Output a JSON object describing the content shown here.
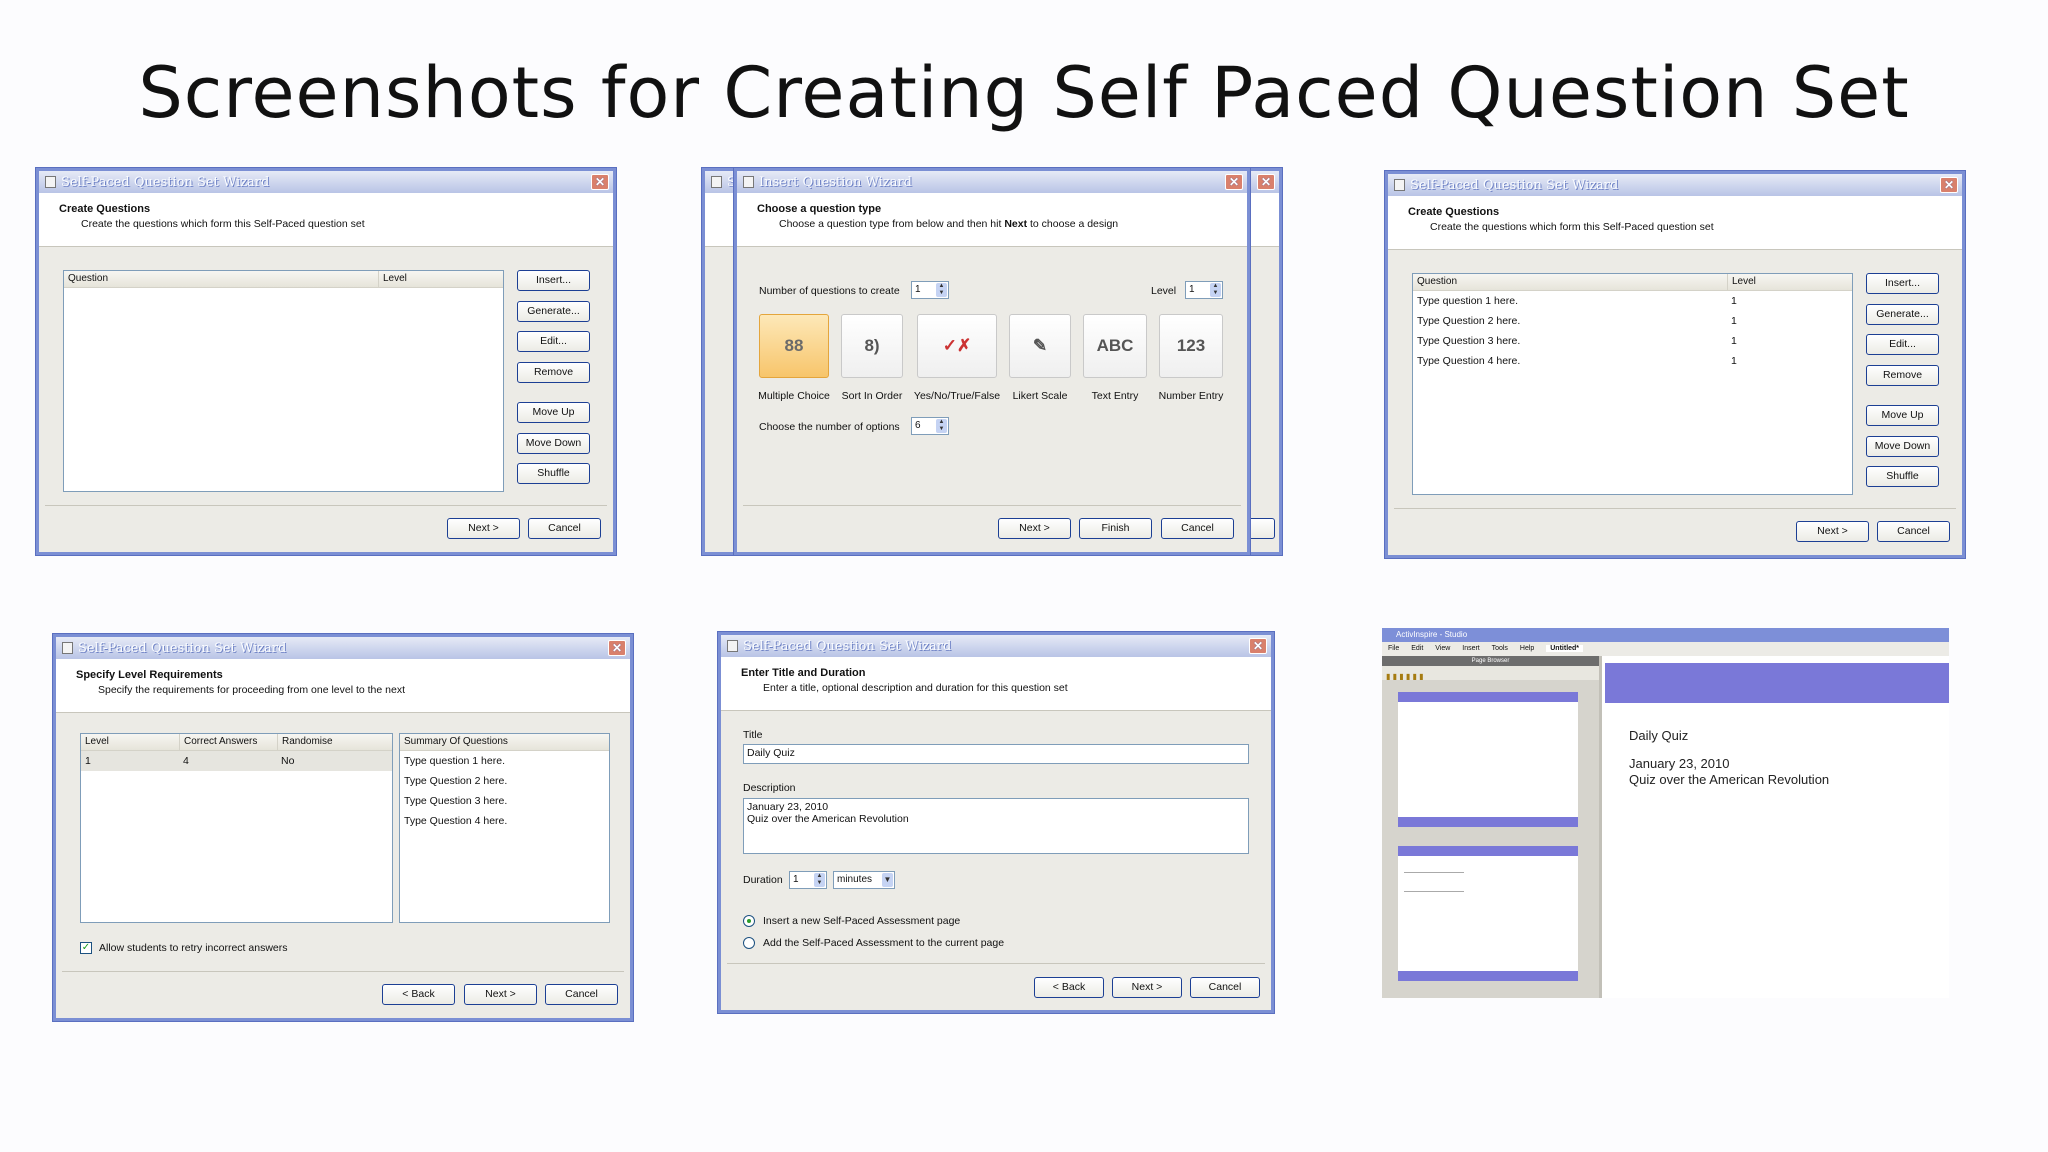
{
  "slide": {
    "title": "Screenshots for Creating Self Paced Question Set"
  },
  "common": {
    "close_glyph": "✕",
    "btn_next": "Next >",
    "btn_back": "< Back",
    "btn_cancel": "Cancel",
    "btn_finish": "Finish"
  },
  "win1": {
    "title": "Self-Paced Question Set Wizard",
    "header_title": "Create Questions",
    "header_sub": "Create the questions which form this Self-Paced question set",
    "col_question": "Question",
    "col_level": "Level",
    "buttons": [
      "Insert...",
      "Generate...",
      "Edit...",
      "Remove",
      "Move Up",
      "Move Down",
      "Shuffle"
    ]
  },
  "win2": {
    "title": "Insert Question Wizard",
    "back_title": "S",
    "header_title": "Choose a question type",
    "header_sub_pre": "Choose a question type from below and then hit ",
    "header_sub_bold": "Next",
    "header_sub_post": " to choose a design",
    "num_label": "Number of questions to create",
    "num_value": "1",
    "level_label": "Level",
    "level_value": "1",
    "types": [
      {
        "label": "Multiple Choice",
        "glyph": "88"
      },
      {
        "label": "Sort In Order",
        "glyph": "8)"
      },
      {
        "label": "Yes/No/True/False",
        "glyph": "✓✗"
      },
      {
        "label": "Likert Scale",
        "glyph": "✎"
      },
      {
        "label": "Text Entry",
        "glyph": "ABC"
      },
      {
        "label": "Number Entry",
        "glyph": "123"
      }
    ],
    "options_label": "Choose the number of options",
    "options_value": "6"
  },
  "win3": {
    "title": "Self-Paced Question Set Wizard",
    "header_title": "Create Questions",
    "header_sub": "Create the questions which form this Self-Paced question set",
    "col_question": "Question",
    "col_level": "Level",
    "rows": [
      {
        "q": "Type question 1 here.",
        "l": "1"
      },
      {
        "q": "Type Question 2 here.",
        "l": "1"
      },
      {
        "q": "Type Question 3 here.",
        "l": "1"
      },
      {
        "q": "Type Question 4 here.",
        "l": "1"
      }
    ],
    "buttons": [
      "Insert...",
      "Generate...",
      "Edit...",
      "Remove",
      "Move Up",
      "Move Down",
      "Shuffle"
    ]
  },
  "win4": {
    "title": "Self-Paced Question Set Wizard",
    "header_title": "Specify Level Requirements",
    "header_sub": "Specify the requirements for proceeding from one level to the next",
    "col_level": "Level",
    "col_correct": "Correct Answers",
    "col_random": "Randomise",
    "row_level": "1",
    "row_correct": "4",
    "row_random": "No",
    "col_summary": "Summary Of Questions",
    "summary": [
      "Type question 1 here.",
      "Type Question 2 here.",
      "Type Question 3 here.",
      "Type Question 4 here."
    ],
    "retry_label": "Allow students to retry incorrect answers"
  },
  "win5": {
    "title": "Self-Paced Question Set Wizard",
    "header_title": "Enter Title and Duration",
    "header_sub": "Enter a title, optional description and duration for this question set",
    "title_label": "Title",
    "title_value": "Daily Quiz",
    "desc_label": "Description",
    "desc_line1": "January 23, 2010",
    "desc_line2": "Quiz over the American Revolution",
    "duration_label": "Duration",
    "duration_value": "1",
    "duration_unit": "minutes",
    "radio1": "Insert a new Self-Paced Assessment page",
    "radio2": "Add the Self-Paced Assessment to the current page"
  },
  "studio": {
    "title": "ActivInspire - Studio",
    "menu": [
      "File",
      "Edit",
      "View",
      "Insert",
      "Tools",
      "Help"
    ],
    "tab": "Untitled*",
    "browser_label": "Page Browser",
    "quiz_title": "Daily Quiz",
    "quiz_date": "January 23, 2010",
    "quiz_desc": "Quiz over the American Revolution"
  }
}
